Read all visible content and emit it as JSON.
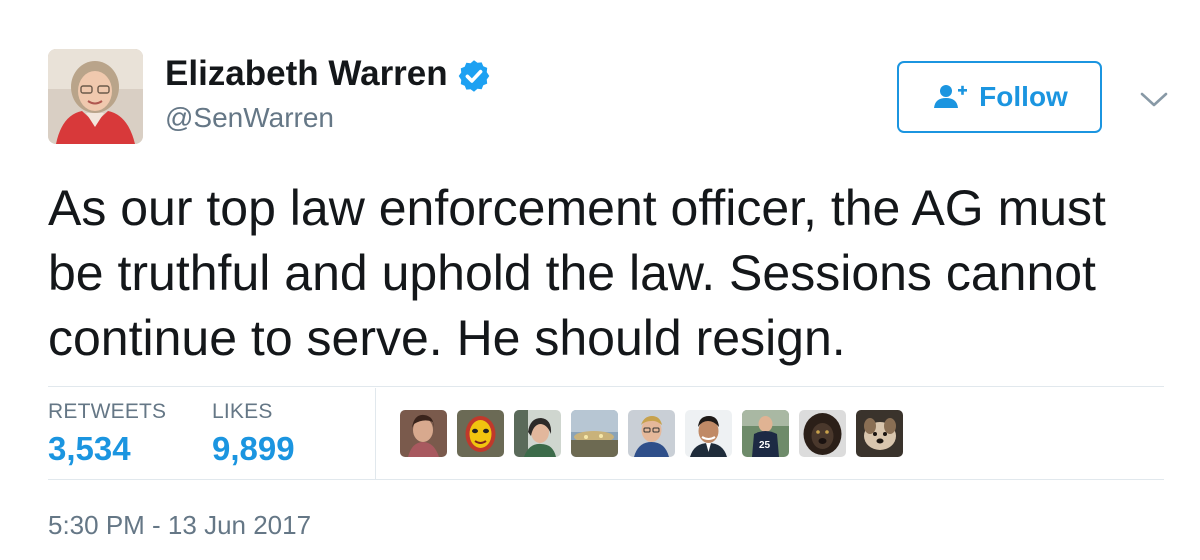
{
  "author": {
    "name": "Elizabeth Warren",
    "handle": "@SenWarren",
    "verified": true,
    "avatar_icon": "profile-photo"
  },
  "follow_button": {
    "label": "Follow",
    "icon": "add-user-icon",
    "color": "#1b95e0"
  },
  "menu_caret_icon": "chevron-down-icon",
  "tweet": {
    "text": "As our top law enforcement officer, the AG must be truthful and uphold the law. Sessions cannot continue to serve. He should resign."
  },
  "stats": {
    "retweets_label": "RETWEETS",
    "retweets_value": "3,534",
    "likes_label": "LIKES",
    "likes_value": "9,899"
  },
  "likers": [
    {
      "icon": "liker-avatar-1"
    },
    {
      "icon": "liker-avatar-2"
    },
    {
      "icon": "liker-avatar-3"
    },
    {
      "icon": "liker-avatar-4"
    },
    {
      "icon": "liker-avatar-5"
    },
    {
      "icon": "liker-avatar-6"
    },
    {
      "icon": "liker-avatar-7"
    },
    {
      "icon": "liker-avatar-8"
    },
    {
      "icon": "liker-avatar-9"
    }
  ],
  "timestamp": "5:30 PM - 13 Jun 2017",
  "colors": {
    "accent": "#1b95e0",
    "secondary_text": "#657786",
    "primary_text": "#14171a",
    "divider": "#e1e8ed"
  }
}
